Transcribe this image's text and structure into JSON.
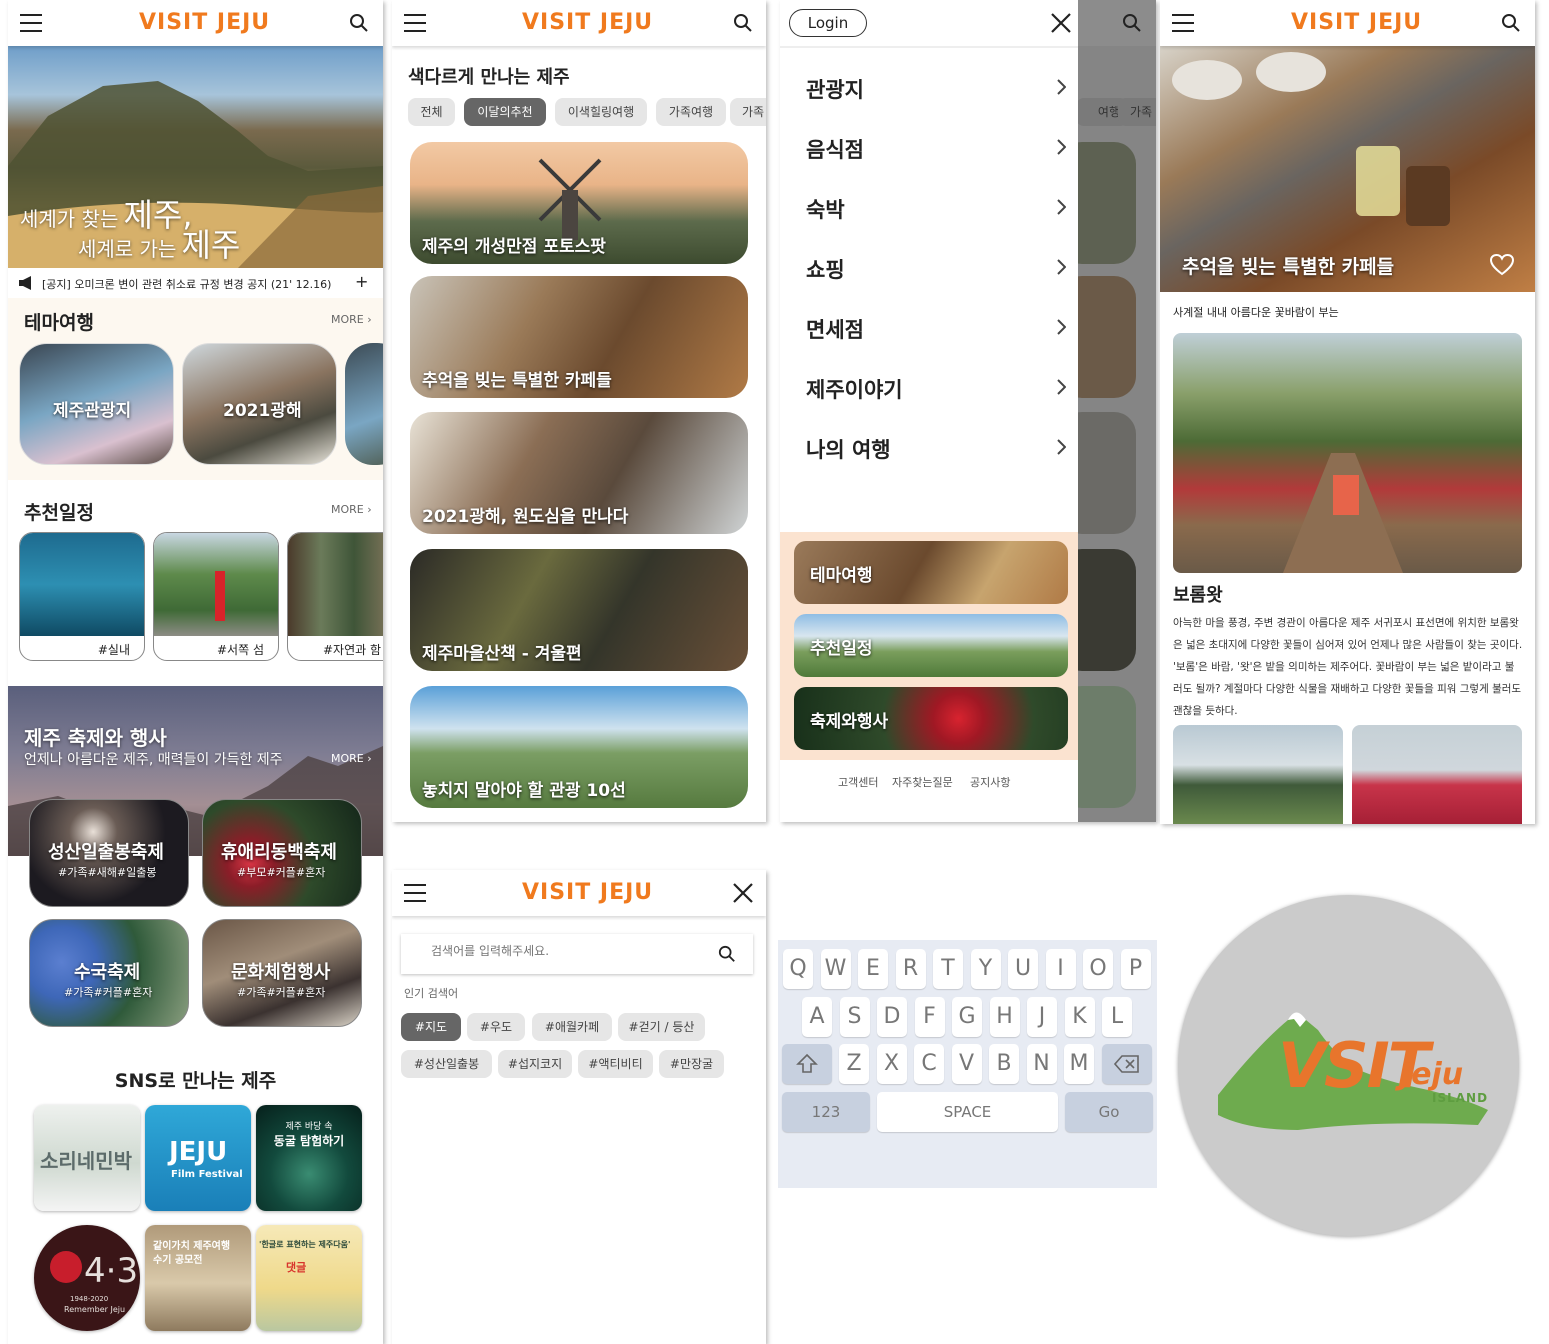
{
  "brand": {
    "logo_text": "VISIT JEJU",
    "accent": "#f07a1e"
  },
  "home": {
    "hero_line1_small": "세계가 찾는",
    "hero_line1_big": "제주,",
    "hero_line2_small": "세계로 가는",
    "hero_line2_big": "제주",
    "notice": "[공지] 오미크론 변이 관련 취소료 규정 변경 공지 (21' 12.16)",
    "notice_plus": "+",
    "theme_title": "테마여행",
    "more": "MORE",
    "theme_cards": [
      "제주관광지",
      "2021광해"
    ],
    "schedule_title": "추천일정",
    "schedule_cards": [
      "#실내",
      "#서쪽 섬",
      "#자연과 함"
    ],
    "festival_title": "제주 축제와 행사",
    "festival_sub": "언제나 아름다운 제주, 매력들이 가득한 제주",
    "festival_cards": [
      {
        "title": "성산일출봉축제",
        "tags": "#가족#새해#일출봉"
      },
      {
        "title": "휴애리동백축제",
        "tags": "#부모#커플#혼자"
      },
      {
        "title": "수국축제",
        "tags": "#가족#커플#혼자"
      },
      {
        "title": "문화체험행사",
        "tags": "#가족#커플#혼자"
      }
    ],
    "sns_title": "SNS로 만나는 제주",
    "sns_tiles": {
      "t1": "소리네민박",
      "t2a": "JEJU",
      "t2b": "Film Festival",
      "t3a": "제주 바당 속",
      "t3b": "동굴 탐험하기",
      "t4a": "4·3",
      "t4b": "1948-2020",
      "t4c": "Remember Jeju",
      "t5a": "같이가치 제주여행",
      "t5b": "수기 공모전",
      "t6a": "'한글로 표현하는 제주다움'",
      "t6b": "댓글"
    }
  },
  "list": {
    "title": "색다르게 만나는 제주",
    "chips": [
      "전체",
      "이달의추천",
      "이색힐링여행",
      "가족여행",
      "가족"
    ],
    "active_chip": "이달의추천",
    "cards": [
      "제주의 개성만점 포토스팟",
      "추억을 빚는 특별한 카페들",
      "2021광해, 원도심을 만나다",
      "제주마을산책 - 겨울편",
      "놓치지 말아야 할 관광 10선"
    ]
  },
  "menu": {
    "login": "Login",
    "items": [
      "관광지",
      "음식점",
      "숙박",
      "쇼핑",
      "면세점",
      "제주이야기",
      "나의 여행"
    ],
    "banners": [
      "테마여행",
      "추천일정",
      "축제와행사"
    ],
    "footer": [
      "고객센터",
      "자주찾는질문",
      "공지사항"
    ],
    "behind_chips": [
      "여행",
      "가족"
    ]
  },
  "detail": {
    "hero_title": "추억을 빚는 특별한 카페들",
    "subtitle": "사계절 내내 아름다운 꽃바람이 부는",
    "place": "보롬왓",
    "body": "아늑한 마을 풍경, 주변 경관이 아름다운 제주 서귀포시 표선면에 위치한 보롬왓은 넓은 초대지에 다양한 꽃들이 심어져 있어 언제나 많은 사람들이 찾는 곳이다. '보롬'은 바람, '왓'은 밭을 의미하는 제주어다. 꽃바람이 부는 넓은 밭이라고 불러도 될까? 계절마다 다양한 식물을 재배하고 다양한 꽃들을 피워 그렇게 불러도 괜찮을 듯하다."
  },
  "search": {
    "placeholder": "검색어를 입력해주세요.",
    "popular_label": "인기 검색어",
    "tags_row1": [
      "#지도",
      "#우도",
      "#애월카페",
      "#걷기 / 등산"
    ],
    "tags_row2": [
      "#성산일출봉",
      "#섭지코지",
      "#액티비티",
      "#만장굴"
    ]
  },
  "keyboard": {
    "row1": [
      "Q",
      "W",
      "E",
      "R",
      "T",
      "Y",
      "U",
      "I",
      "O",
      "P"
    ],
    "row2": [
      "A",
      "S",
      "D",
      "F",
      "G",
      "H",
      "J",
      "K",
      "L"
    ],
    "row3": [
      "Z",
      "X",
      "C",
      "V",
      "B",
      "N",
      "M"
    ],
    "num": "123",
    "space": "SPACE",
    "go": "Go"
  },
  "app_icon": {
    "word1": "VSIT",
    "word2": "Jeju",
    "word3": "ISLAND"
  }
}
